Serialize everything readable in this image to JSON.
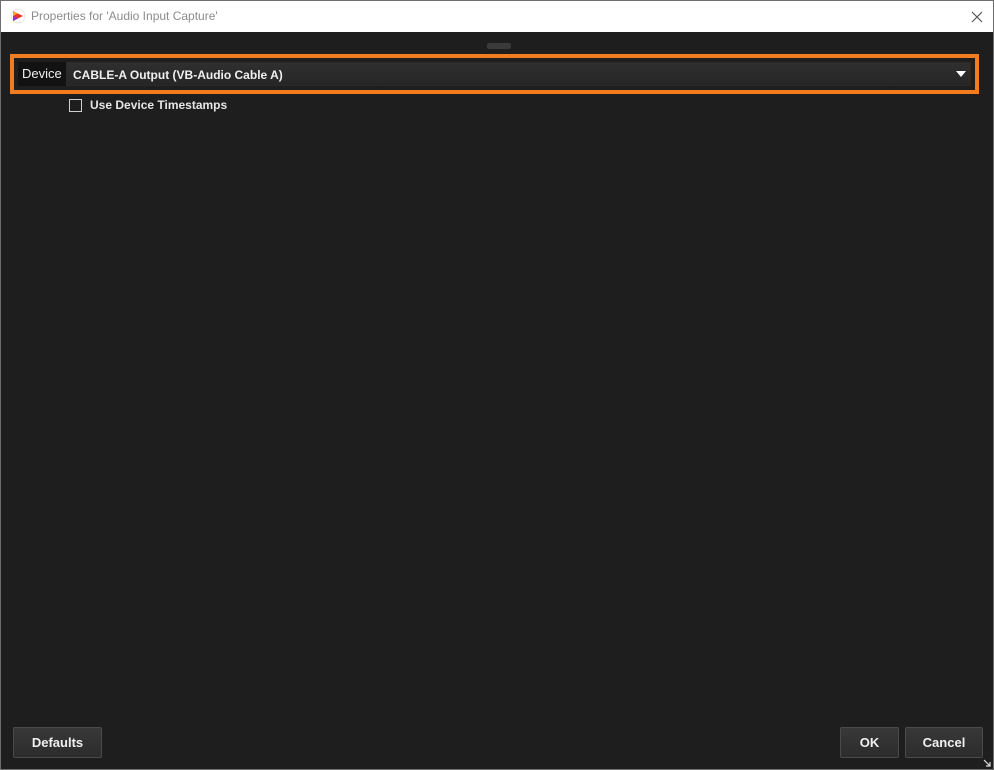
{
  "window": {
    "title": "Properties for 'Audio Input Capture'"
  },
  "device": {
    "label": "Device",
    "selected_value": "CABLE-A Output (VB-Audio Cable A)"
  },
  "options": {
    "use_timestamps_label": "Use Device Timestamps",
    "use_timestamps_checked": false
  },
  "buttons": {
    "defaults_label": "Defaults",
    "ok_label": "OK",
    "cancel_label": "Cancel"
  },
  "colors": {
    "highlight": "#f27c1e",
    "background": "#1e1e1e"
  },
  "icons": {
    "app": "obs-app-icon",
    "close": "close-icon",
    "dropdown": "chevron-down-icon",
    "resize": "resize-grip-icon"
  }
}
